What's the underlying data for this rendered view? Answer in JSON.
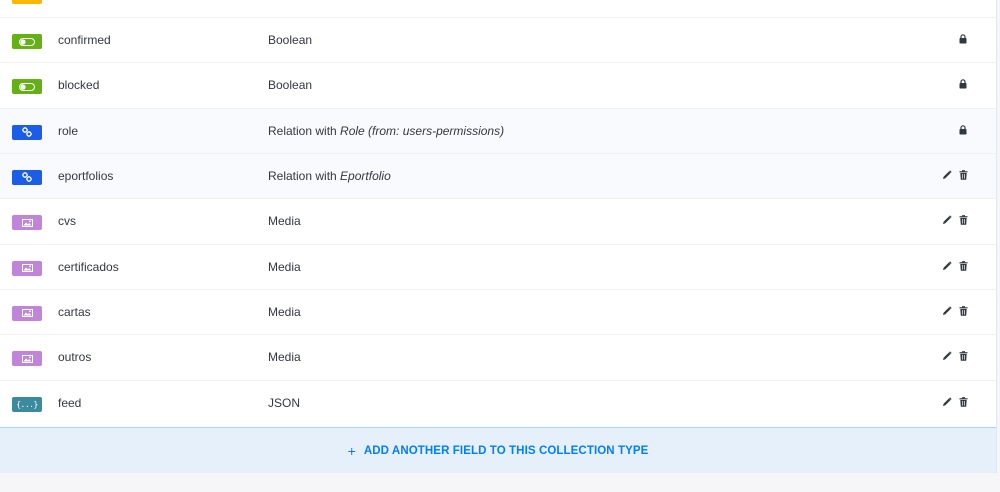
{
  "fields": [
    {
      "type_icon": "boolean-icon",
      "name": "confirmed",
      "desc_plain": "Boolean",
      "desc_em": "",
      "locked": true,
      "highlight": false
    },
    {
      "type_icon": "boolean-icon",
      "name": "blocked",
      "desc_plain": "Boolean",
      "desc_em": "",
      "locked": true,
      "highlight": false
    },
    {
      "type_icon": "relation-icon",
      "name": "role",
      "desc_plain": "Relation with ",
      "desc_em": "Role (from: users-permissions)",
      "locked": true,
      "highlight": true
    },
    {
      "type_icon": "relation-icon",
      "name": "eportfolios",
      "desc_plain": "Relation with ",
      "desc_em": "Eportfolio",
      "locked": false,
      "highlight": true
    },
    {
      "type_icon": "media-icon",
      "name": "cvs",
      "desc_plain": "Media",
      "desc_em": "",
      "locked": false,
      "highlight": false
    },
    {
      "type_icon": "media-icon",
      "name": "certificados",
      "desc_plain": "Media",
      "desc_em": "",
      "locked": false,
      "highlight": false
    },
    {
      "type_icon": "media-icon",
      "name": "cartas",
      "desc_plain": "Media",
      "desc_em": "",
      "locked": false,
      "highlight": false
    },
    {
      "type_icon": "media-icon",
      "name": "outros",
      "desc_plain": "Media",
      "desc_em": "",
      "locked": false,
      "highlight": false
    },
    {
      "type_icon": "json-icon",
      "name": "feed",
      "desc_plain": "JSON",
      "desc_em": "",
      "locked": false,
      "highlight": false
    }
  ],
  "add_field": {
    "icon": "plus-icon",
    "label": "ADD ANOTHER FIELD TO THIS COLLECTION TYPE"
  },
  "colors": {
    "boolean": "#65b115",
    "relation": "#1c5de7",
    "media": "#c085d9",
    "json": "#3c8a9d",
    "accent": "#007eff"
  }
}
